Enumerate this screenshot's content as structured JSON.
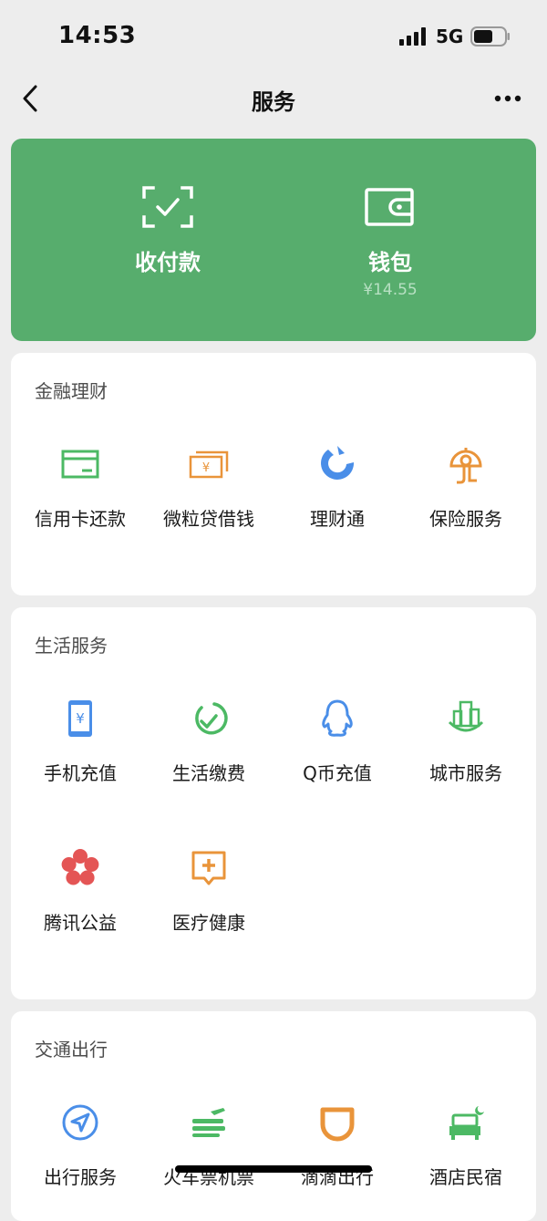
{
  "status_bar": {
    "time": "14:53",
    "network": "5G"
  },
  "nav": {
    "title": "服务"
  },
  "hero": {
    "pay": {
      "label": "收付款"
    },
    "wallet": {
      "label": "钱包",
      "balance": "¥14.55"
    }
  },
  "sections": {
    "finance": {
      "title": "金融理财",
      "items": [
        {
          "label": "信用卡还款",
          "icon": "credit-card-icon"
        },
        {
          "label": "微粒贷借钱",
          "icon": "loan-bills-icon"
        },
        {
          "label": "理财通",
          "icon": "wealth-icon"
        },
        {
          "label": "保险服务",
          "icon": "insurance-icon"
        }
      ]
    },
    "life": {
      "title": "生活服务",
      "items": [
        {
          "label": "手机充值",
          "icon": "phone-recharge-icon"
        },
        {
          "label": "生活缴费",
          "icon": "utility-bill-icon"
        },
        {
          "label": "Q币充值",
          "icon": "penguin-icon"
        },
        {
          "label": "城市服务",
          "icon": "city-icon"
        },
        {
          "label": "腾讯公益",
          "icon": "charity-flower-icon"
        },
        {
          "label": "医疗健康",
          "icon": "medical-plus-icon"
        }
      ]
    },
    "transport": {
      "title": "交通出行",
      "items": [
        {
          "label": "出行服务",
          "icon": "navigation-arrow-icon"
        },
        {
          "label": "火车票机票",
          "icon": "train-plane-icon"
        },
        {
          "label": "滴滴出行",
          "icon": "didi-icon"
        },
        {
          "label": "酒店民宿",
          "icon": "hotel-bed-icon"
        }
      ]
    }
  },
  "colors": {
    "hero_green": "#57ad6d",
    "icon_green": "#4cb964",
    "icon_orange": "#e9943a",
    "icon_blue": "#4a8ee8",
    "icon_red": "#e45555",
    "background": "#ededed"
  }
}
